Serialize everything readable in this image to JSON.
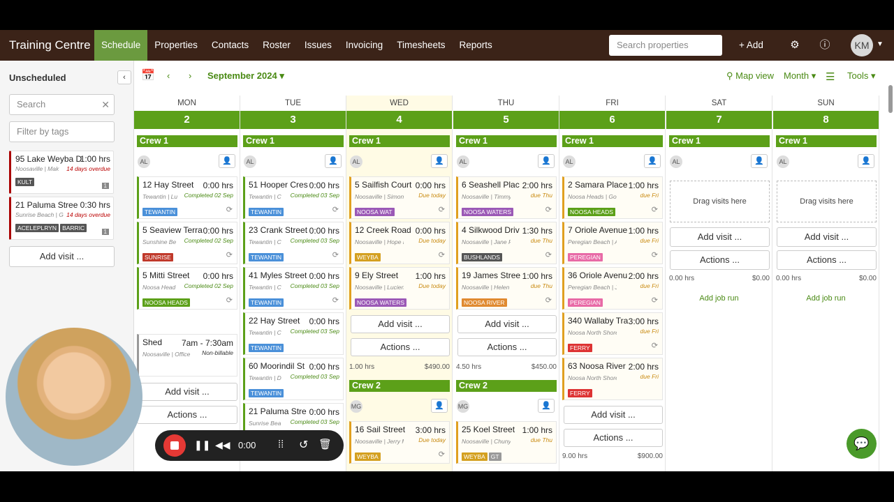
{
  "nav": {
    "brand": "Training Centre",
    "items": [
      "Schedule",
      "Properties",
      "Contacts",
      "Roster",
      "Issues",
      "Invoicing",
      "Timesheets",
      "Reports"
    ],
    "search_placeholder": "Search properties",
    "add": "+ Add",
    "user": "KM"
  },
  "sidebar": {
    "title": "Unscheduled",
    "search": "Search",
    "filter": "Filter by tags",
    "cards": [
      {
        "addr": "95 Lake Weyba D",
        "hrs": "1:00 hrs",
        "sub": "Noosaville | Mak",
        "status": "14 days overdue",
        "tags": [
          "KULT"
        ],
        "count": "1"
      },
      {
        "addr": "21 Paluma Stree",
        "hrs": "0:30 hrs",
        "sub": "Sunrise Beach | G",
        "status": "14 days overdue",
        "tags": [
          "ACELEPLRYN",
          "BARRIC"
        ],
        "count": "1"
      }
    ],
    "add_visit": "Add visit ..."
  },
  "toolbar": {
    "month": "September 2024",
    "map": "Map view",
    "view": "Month",
    "tools": "Tools"
  },
  "days": [
    {
      "name": "MON",
      "num": "2"
    },
    {
      "name": "TUE",
      "num": "3"
    },
    {
      "name": "WED",
      "num": "4"
    },
    {
      "name": "THU",
      "num": "5"
    },
    {
      "name": "FRI",
      "num": "6"
    },
    {
      "name": "SAT",
      "num": "7"
    },
    {
      "name": "SUN",
      "num": "8"
    }
  ],
  "crew1": "Crew 1",
  "crew2": "Crew 2",
  "mon": [
    {
      "t": "12 Hay Street",
      "h": "0:00 hrs",
      "s": "Tewantin | Lu",
      "st": "Completed 02 Sep",
      "tag": "TEWANTIN"
    },
    {
      "t": "5 Seaview Terra",
      "h": "0:00 hrs",
      "s": "Sunshine Be",
      "st": "Completed 02 Sep",
      "tag": "SUNRISE"
    },
    {
      "t": "5 Mitti Street",
      "h": "0:00 hrs",
      "s": "Noosa Head",
      "st": "Completed 02 Sep",
      "tag": "NOOSA HEADS"
    }
  ],
  "mon_shed": {
    "t": "Shed",
    "h": "7am - 7:30am",
    "s": "Noosaville | Office",
    "st": "Non-billable"
  },
  "tue": [
    {
      "t": "51 Hooper Cres",
      "h": "0:00 hrs",
      "s": "Tewantin | C",
      "st": "Completed 03 Sep",
      "tag": "TEWANTIN"
    },
    {
      "t": "23 Crank Street",
      "h": "0:00 hrs",
      "s": "Tewantin | C",
      "st": "Completed 03 Sep",
      "tag": "TEWANTIN"
    },
    {
      "t": "41 Myles Street",
      "h": "0:00 hrs",
      "s": "Tewantin | C",
      "st": "Completed 03 Sep",
      "tag": "TEWANTIN"
    },
    {
      "t": "22 Hay Street",
      "h": "0:00 hrs",
      "s": "Tewantin | C",
      "st": "Completed 03 Sep",
      "tag": "TEWANTIN"
    },
    {
      "t": "60 Moorindil St",
      "h": "0:00 hrs",
      "s": "Tewantin | D",
      "st": "Completed 03 Sep",
      "tag": "TEWANTIN"
    },
    {
      "t": "21 Paluma Stre",
      "h": "0:00 hrs",
      "s": "Sunrise Bea",
      "st": "Completed 03 Sep"
    }
  ],
  "wed": [
    {
      "t": "5 Sailfish Court",
      "h": "0:00 hrs",
      "s": "Noosaville | Simon B",
      "st": "Due today",
      "tag": "NOOSA WAT"
    },
    {
      "t": "12 Creek Road",
      "h": "0:00 hrs",
      "s": "Noosaville | Hope Bo",
      "st": "Due today",
      "tag": "WEYBA"
    },
    {
      "t": "9 Ely Street",
      "h": "1:00 hrs",
      "s": "Noosaville | Lucien D",
      "st": "Due today",
      "tag": "NOOSA WATERS"
    }
  ],
  "wed_sum": {
    "h": "1.00 hrs",
    "v": "$490.00"
  },
  "wed2": {
    "t": "16 Sail Street",
    "h": "3:00 hrs",
    "s": "Noosaville | Jerry Ma",
    "st": "Due today",
    "tag": "WEYBA"
  },
  "thu": [
    {
      "t": "6 Seashell Plac",
      "h": "2:00 hrs",
      "s": "Noosaville | Timmy Ra",
      "st": "due Thu",
      "tag": "NOOSA WATERS"
    },
    {
      "t": "4 Silkwood Driv",
      "h": "1:30 hrs",
      "s": "Noosaville | Jane Figle",
      "st": "due Thu",
      "tag": "BUSHLANDS"
    },
    {
      "t": "19 James Stree",
      "h": "1:00 hrs",
      "s": "Noosaville | Helen King",
      "st": "due Thu",
      "tag": "NOOSA RIVER"
    }
  ],
  "thu_sum": {
    "h": "4.50 hrs",
    "v": "$450.00"
  },
  "thu2": {
    "t": "25 Koel Street",
    "h": "1:00 hrs",
    "s": "Noosaville | Chuny Mar",
    "st": "due Thu",
    "tag": "WEYBA",
    "tag2": "GT"
  },
  "fri": [
    {
      "t": "2 Samara Place",
      "h": "1:00 hrs",
      "s": "Noosa Heads | Goran Vi",
      "st": "due Fri",
      "tag": "NOOSA HEADS"
    },
    {
      "t": "7 Oriole Avenue",
      "h": "1:00 hrs",
      "s": "Peregian Beach | Alex K",
      "st": "due Fri",
      "tag": "PEREGIAN"
    },
    {
      "t": "36 Oriole Avenu",
      "h": "2:00 hrs",
      "s": "Peregian Beach | Julian",
      "st": "due Fri",
      "tag": "PEREGIAN"
    },
    {
      "t": "340 Wallaby Tra",
      "h": "3:00 hrs",
      "s": "Noosa North Shore | La",
      "st": "due Fri",
      "tag": "FERRY"
    },
    {
      "t": "63 Noosa River",
      "h": "2:00 hrs",
      "s": "Noosa North Shore | Eri",
      "st": "due Fri",
      "tag": "FERRY"
    }
  ],
  "fri_sum": {
    "h": "9.00 hrs",
    "v": "$900.00"
  },
  "wk_sum": {
    "h": "0.00 hrs",
    "v": "$0.00"
  },
  "labels": {
    "drag": "Drag visits here",
    "add_visit": "Add visit ...",
    "actions": "Actions ...",
    "job_run": "Add job run",
    "mini_al": "AL",
    "mini_mg": "MG"
  },
  "recorder": {
    "time": "0:00"
  }
}
